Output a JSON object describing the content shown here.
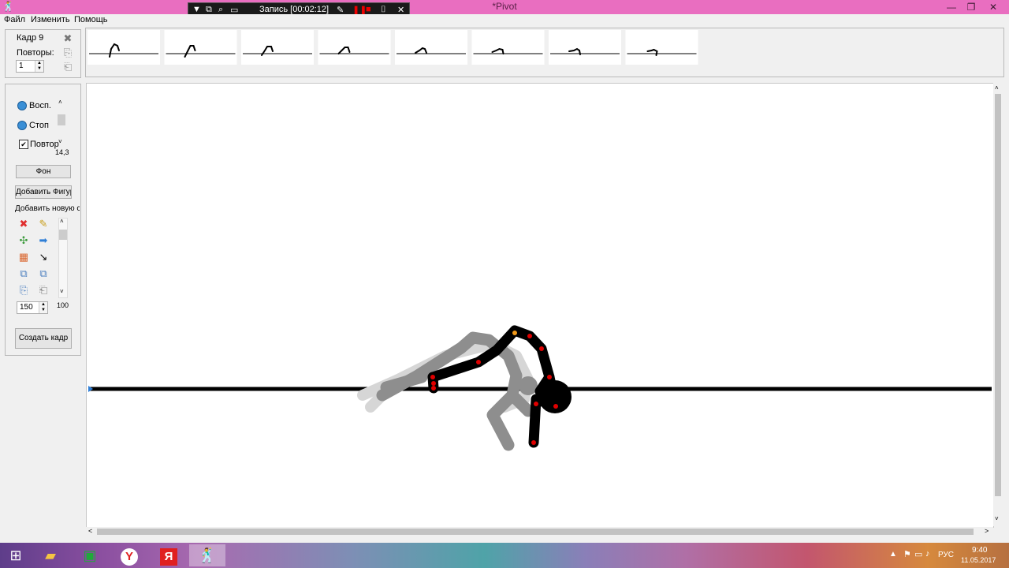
{
  "window": {
    "title": "*Pivot",
    "app_icon": "stickman-icon"
  },
  "menu": [
    "Файл",
    "Изменить",
    "Помощь"
  ],
  "recorder": {
    "label": "Запись [00:02:12]"
  },
  "frame_panel": {
    "frame_label": "Кадр 9",
    "repeats_label": "Повторы:",
    "repeats_value": "1"
  },
  "timeline": {
    "frame_count": 8
  },
  "controls": {
    "play_label": "Восп.",
    "stop_label": "Стоп",
    "loop_label": "Повтор",
    "loop_checked": true,
    "speed_value": "14,3",
    "background_button": "Фон",
    "add_figure_button": "Добавить Фигур",
    "add_new_label": "Добавить новую с",
    "size_value": "150",
    "size_side_value": "100",
    "create_frame_button": "Создать кадр"
  },
  "taskbar": {
    "language": "РУС",
    "time": "9:40",
    "date": "11.05.2017",
    "apps": [
      "start-icon",
      "file-explorer-icon",
      "store-icon",
      "yandex-browser-icon",
      "yandex-icon",
      "pivot-icon"
    ]
  },
  "colors": {
    "titlebar": "#e96ec0",
    "figure": "#000000",
    "joint": "#e00000",
    "joint_origin": "#f29a1a"
  }
}
